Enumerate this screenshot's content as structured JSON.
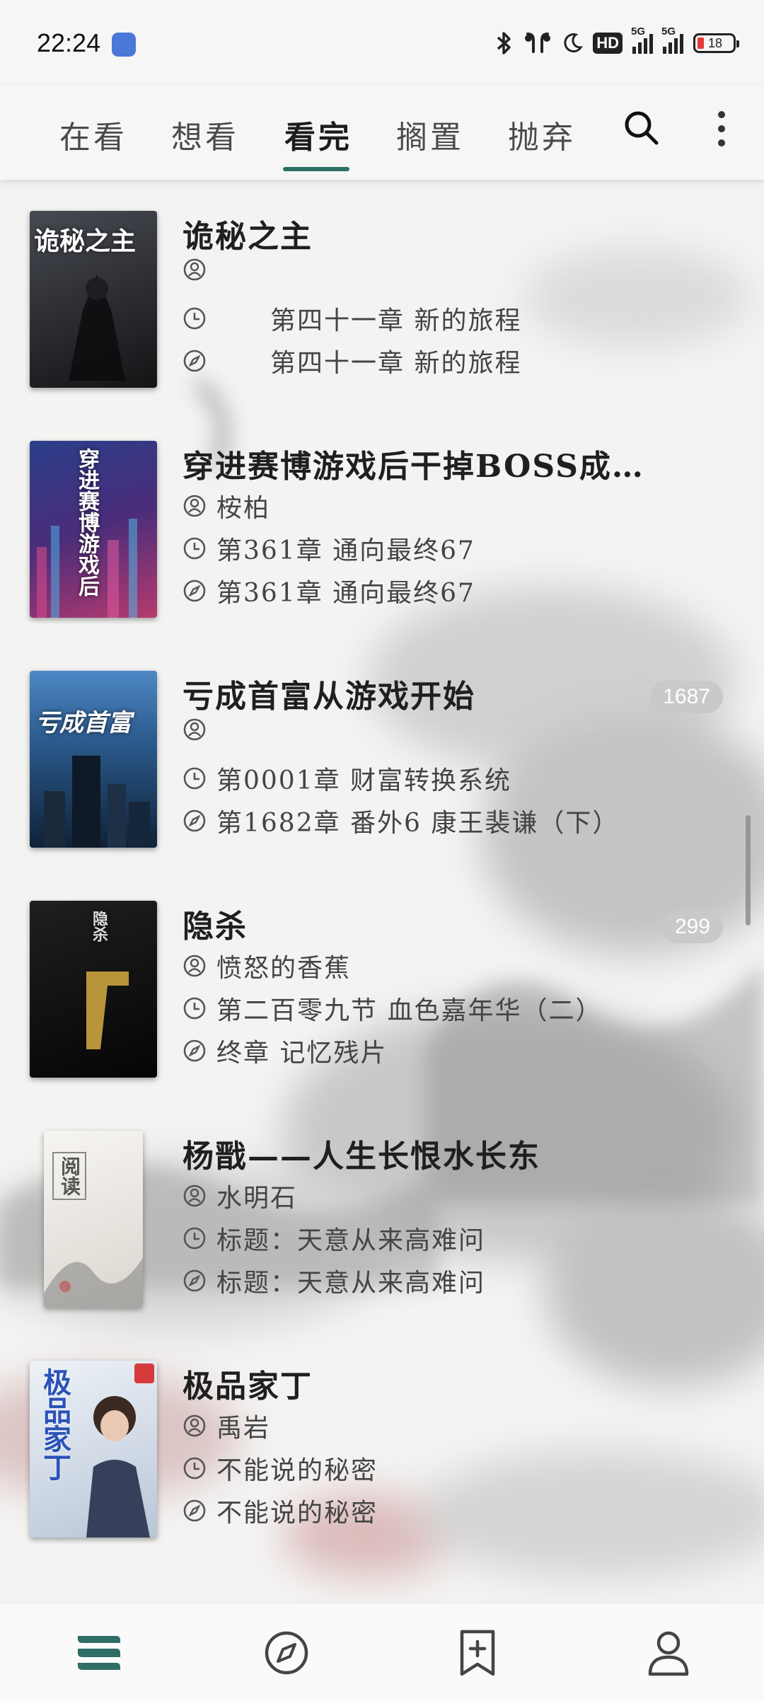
{
  "status_bar": {
    "time": "22:24",
    "hd_label": "HD",
    "sim1_label": "5G",
    "sim2_label": "5G",
    "battery_level": "18",
    "battery_color": "#e63a3a"
  },
  "tabs": [
    {
      "label": "在看",
      "active": false
    },
    {
      "label": "想看",
      "active": false
    },
    {
      "label": "看完",
      "active": true
    },
    {
      "label": "搁置",
      "active": false
    },
    {
      "label": "抛弃",
      "active": false
    }
  ],
  "accent_color": "#2f6e66",
  "books": [
    {
      "title": "诡秘之主",
      "author": "",
      "last_read": "　　第四十一章 新的旅程",
      "latest": "　　第四十一章 新的旅程",
      "count": "",
      "cover_text": "诡秘之主",
      "cover_colors": [
        "#3b3d44",
        "#141416"
      ]
    },
    {
      "title": "穿进赛博游戏后干掉BOSS成…",
      "author": "桉柏",
      "last_read": "第361章 通向最终67",
      "latest": "第361章 通向最终67",
      "count": "",
      "cover_text": "穿进赛博游戏后",
      "cover_colors": [
        "#2b3e8a",
        "#7a2a66"
      ]
    },
    {
      "title": "亏成首富从游戏开始",
      "author": "",
      "last_read": "第0001章 财富转换系统",
      "latest": "第1682章 番外6 康王裴谦（下）",
      "count": "1687",
      "cover_text": "亏成首富",
      "cover_colors": [
        "#2b5a8c",
        "#0f2238"
      ]
    },
    {
      "title": "隐杀",
      "author": "愤怒的香蕉",
      "last_read": "第二百零九节 血色嘉年华（二）",
      "latest": "终章 记忆残片",
      "count": "299",
      "cover_text": "隐杀",
      "cover_colors": [
        "#1a1a1a",
        "#050505"
      ]
    },
    {
      "title": "杨戬——人生长恨水长东",
      "author": "水明石",
      "last_read": "标题：天意从来高难问",
      "latest": "标题：天意从来高难问",
      "count": "",
      "cover_text": "阅读",
      "cover_colors": [
        "#f4f2ee",
        "#d9d6cf"
      ]
    },
    {
      "title": "极品家丁",
      "author": "禹岩",
      "last_read": "不能说的秘密",
      "latest": "不能说的秘密",
      "count": "",
      "cover_text": "极品家丁",
      "cover_colors": [
        "#e9eef5",
        "#b9c6d8"
      ]
    }
  ],
  "bottom_nav": [
    {
      "icon": "bookshelf-icon",
      "active": true
    },
    {
      "icon": "compass-icon",
      "active": false
    },
    {
      "icon": "bookmark-add-icon",
      "active": false
    },
    {
      "icon": "person-icon",
      "active": false
    }
  ]
}
